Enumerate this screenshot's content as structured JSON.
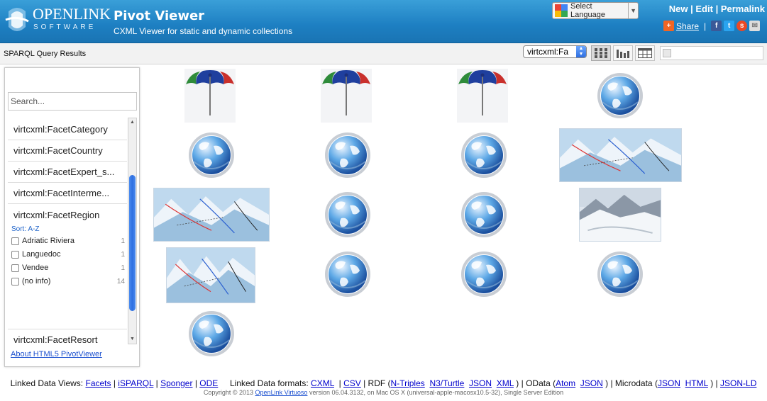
{
  "header": {
    "logo_text": "OPENLINK",
    "logo_sub": "SOFTWARE",
    "title": "Pivot Viewer",
    "subtitle": "CXML Viewer for static and dynamic collections",
    "language_label": "Select Language",
    "links": {
      "new": "New",
      "edit": "Edit",
      "permalink": "Permalink",
      "sep": "|"
    },
    "share_label": "Share"
  },
  "toolbar": {
    "query_title": "SPARQL Query Results",
    "sort_value": "virtcxml:Fa",
    "views": [
      "grid-view",
      "graph-view",
      "table-view"
    ]
  },
  "sidebar": {
    "search_placeholder": "Search...",
    "facets": {
      "category": "virtcxml:FacetCategory",
      "country": "virtcxml:FacetCountry",
      "expert": "virtcxml:FacetExpert_s...",
      "intermediate": "virtcxml:FacetInterme...",
      "region": "virtcxml:FacetRegion",
      "resort": "virtcxml:FacetResort"
    },
    "sort_label": "Sort: A-Z",
    "options": [
      {
        "label": "Adriatic Riviera",
        "count": "1"
      },
      {
        "label": "Languedoc",
        "count": "1"
      },
      {
        "label": "Vendee",
        "count": "1"
      },
      {
        "label": "(no info)",
        "count": "14"
      }
    ],
    "about_link": "About HTML5 PivotViewer"
  },
  "items": [
    {
      "kind": "umbrella"
    },
    {
      "kind": "umbrella"
    },
    {
      "kind": "umbrella"
    },
    {
      "kind": "globe"
    },
    {
      "kind": "globe"
    },
    {
      "kind": "globe"
    },
    {
      "kind": "globe"
    },
    {
      "kind": "piste-map"
    },
    {
      "kind": "piste-map"
    },
    {
      "kind": "globe"
    },
    {
      "kind": "globe"
    },
    {
      "kind": "snow-photo"
    },
    {
      "kind": "piste-map"
    },
    {
      "kind": "globe"
    },
    {
      "kind": "globe"
    },
    {
      "kind": "globe"
    },
    {
      "kind": "globe"
    }
  ],
  "footer": {
    "views_label": "Linked Data Views:",
    "facets": "Facets",
    "isparql": "iSPARQL",
    "sponger": "Sponger",
    "ode": "ODE",
    "formats_label": "Linked Data formats:",
    "cxml": "CXML",
    "csv": "CSV",
    "rdf_label": "RDF (",
    "ntriples": "N-Triples",
    "n3": "N3/Turtle",
    "json": "JSON",
    "xml": "XML",
    "odata_label": ") | OData (",
    "atom": "Atom",
    "odata_json": "JSON",
    "microdata_label": ") | Microdata (",
    "md_json": "JSON",
    "md_html": "HTML",
    "jsonld_sep": ") |",
    "jsonld": "JSON-LD",
    "copyright_pre": "Copyright © 2013",
    "virtuoso": "OpenLink Virtuoso",
    "copyright_post": "version 06.04.3132, on Mac OS X (universal-apple-macosx10.5-32), Single Server Edition"
  }
}
